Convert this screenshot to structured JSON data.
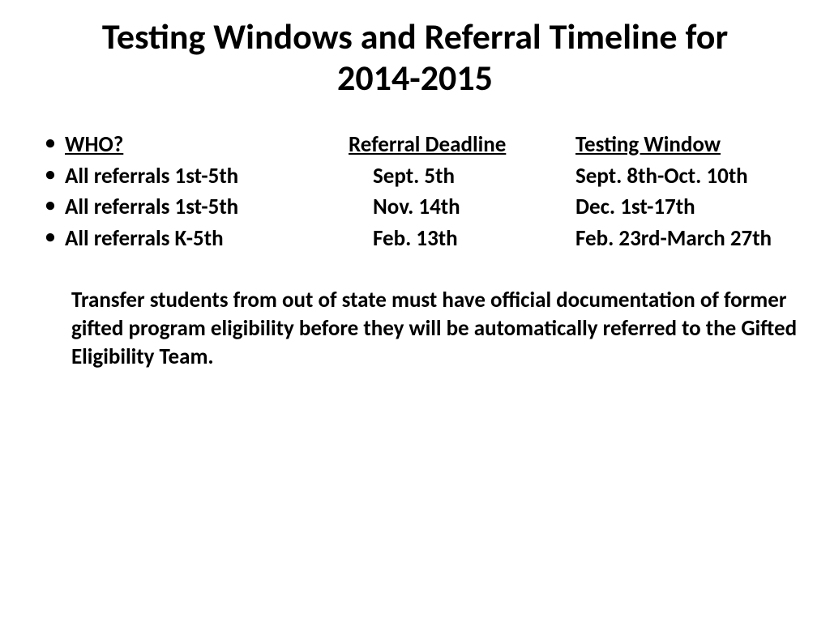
{
  "title": "Testing Windows and Referral Timeline for 2014-2015",
  "headers": {
    "who": "WHO?",
    "deadline": "Referral Deadline",
    "window": "Testing Window"
  },
  "rows": [
    {
      "who": "All referrals 1st-5th",
      "deadline": "Sept. 5th",
      "window": "Sept. 8th-Oct. 10th"
    },
    {
      "who": "All referrals 1st-5th",
      "deadline": "Nov. 14th",
      "window": "Dec. 1st-17th"
    },
    {
      "who": "All referrals K-5th",
      "deadline": "Feb. 13th",
      "window": "Feb. 23rd-March 27th"
    }
  ],
  "note": "Transfer students from out of state must have official documentation of former gifted program eligibility before they will be automatically referred to the Gifted Eligibility Team."
}
